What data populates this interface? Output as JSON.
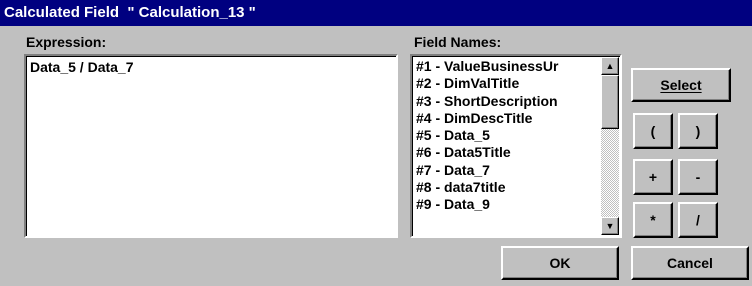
{
  "window": {
    "title": "Calculated Field  \" Calculation_13 \""
  },
  "expression": {
    "label": "Expression:",
    "value": "Data_5 / Data_7"
  },
  "fields": {
    "label": "Field Names:",
    "items": [
      "#1 - ValueBusinessUr",
      "#2 - DimValTitle",
      "#3 - ShortDescription",
      "#4 - DimDescTitle",
      "#5 - Data_5",
      "#6 - Data5Title",
      "#7 - Data_7",
      "#8 - data7title",
      "#9 - Data_9"
    ]
  },
  "buttons": {
    "select": "Select",
    "open_paren": "(",
    "close_paren": ")",
    "plus": "+",
    "minus": "-",
    "multiply": "*",
    "divide": "/",
    "ok": "OK",
    "cancel": "Cancel"
  },
  "icons": {
    "scroll_up": "up-arrow",
    "scroll_down": "down-arrow"
  }
}
